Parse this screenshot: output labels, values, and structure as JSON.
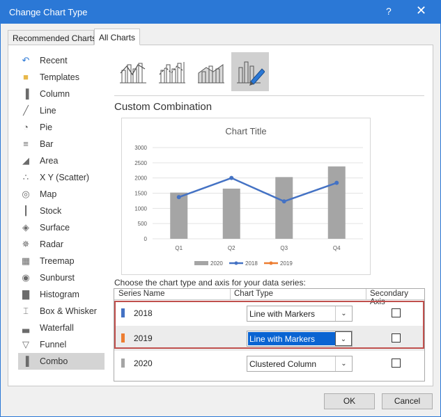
{
  "window": {
    "title": "Change Chart Type",
    "help_glyph": "?",
    "close_glyph": "✕"
  },
  "tabs": [
    {
      "label": "Recommended Charts"
    },
    {
      "label": "All Charts"
    }
  ],
  "sidebar": {
    "items": [
      {
        "label": "Recent",
        "icon": "recent-icon"
      },
      {
        "label": "Templates",
        "icon": "folder-icon"
      },
      {
        "label": "Column",
        "icon": "column-chart-icon"
      },
      {
        "label": "Line",
        "icon": "line-chart-icon"
      },
      {
        "label": "Pie",
        "icon": "pie-chart-icon"
      },
      {
        "label": "Bar",
        "icon": "bar-chart-icon"
      },
      {
        "label": "Area",
        "icon": "area-chart-icon"
      },
      {
        "label": "X Y (Scatter)",
        "icon": "scatter-chart-icon"
      },
      {
        "label": "Map",
        "icon": "map-chart-icon"
      },
      {
        "label": "Stock",
        "icon": "stock-chart-icon"
      },
      {
        "label": "Surface",
        "icon": "surface-chart-icon"
      },
      {
        "label": "Radar",
        "icon": "radar-chart-icon"
      },
      {
        "label": "Treemap",
        "icon": "treemap-chart-icon"
      },
      {
        "label": "Sunburst",
        "icon": "sunburst-chart-icon"
      },
      {
        "label": "Histogram",
        "icon": "histogram-chart-icon"
      },
      {
        "label": "Box & Whisker",
        "icon": "box-whisker-chart-icon"
      },
      {
        "label": "Waterfall",
        "icon": "waterfall-chart-icon"
      },
      {
        "label": "Funnel",
        "icon": "funnel-chart-icon"
      },
      {
        "label": "Combo",
        "icon": "combo-chart-icon"
      }
    ],
    "selected": "Combo"
  },
  "subtypes": {
    "selected_index": 3
  },
  "section_title": "Custom Combination",
  "chart_data": {
    "type": "bar",
    "title": "Chart Title",
    "categories": [
      "Q1",
      "Q2",
      "Q3",
      "Q4"
    ],
    "series": [
      {
        "name": "2020",
        "render": "column",
        "color": "#a5a5a5",
        "values": [
          1520,
          1650,
          2030,
          2380
        ]
      },
      {
        "name": "2018",
        "render": "line-markers",
        "color": "#4472c4",
        "values": [
          1370,
          2000,
          1230,
          1840
        ]
      },
      {
        "name": "2019",
        "render": "line-markers",
        "color": "#ed7d31",
        "values": []
      }
    ],
    "ylim": [
      0,
      3000
    ],
    "yticks": [
      "0",
      "500",
      "1000",
      "1500",
      "2000",
      "2500",
      "3000"
    ],
    "grid": true,
    "legend": "bottom"
  },
  "series_table": {
    "prompt": "Choose the chart type and axis for your data series:",
    "headers": {
      "name": "Series Name",
      "type": "Chart Type",
      "axis": "Secondary Axis"
    },
    "rows": [
      {
        "name": "2018",
        "color": "#4472c4",
        "chart_type": "Line with Markers",
        "secondary": false
      },
      {
        "name": "2019",
        "color": "#ed7d31",
        "chart_type": "Line with Markers",
        "secondary": false
      },
      {
        "name": "2020",
        "color": "#a5a5a5",
        "chart_type": "Clustered Column",
        "secondary": false
      }
    ],
    "dropdown_glyph": "⌄"
  },
  "buttons": {
    "ok": "OK",
    "cancel": "Cancel"
  }
}
